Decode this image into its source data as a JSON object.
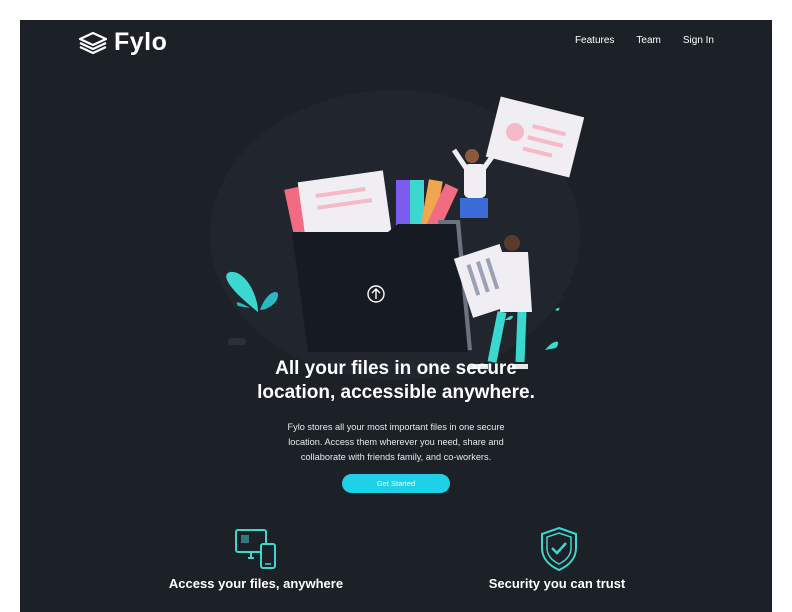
{
  "brand": {
    "name": "Fylo"
  },
  "nav": {
    "features": "Features",
    "team": "Team",
    "sign_in": "Sign In"
  },
  "hero": {
    "title_line1": "All your files in one secure",
    "title_line2": "location, accessible anywhere.",
    "description_line1": "Fylo stores all your most important files in one secure",
    "description_line2": "location. Access them wherever you need, share and",
    "description_line3": "collaborate with friends family, and co-workers.",
    "cta": "Get Started"
  },
  "features": [
    {
      "title": "Access your files, anywhere",
      "icon": "devices-icon"
    },
    {
      "title": "Security you can trust",
      "icon": "shield-check-icon"
    }
  ],
  "colors": {
    "background": "#1c2027",
    "accent": "#1fd0e8",
    "teal": "#3ad8cf"
  }
}
